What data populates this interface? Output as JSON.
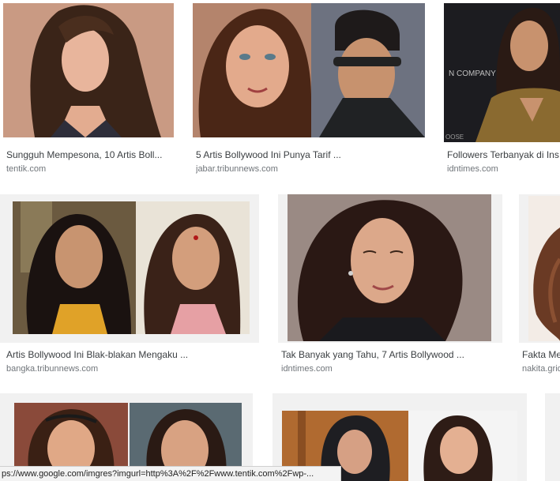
{
  "results": [
    {
      "title": "Sungguh Mempesona, 10 Artis Boll...",
      "source": "tentik.com"
    },
    {
      "title": "5 Artis Bollywood Ini Punya Tarif ...",
      "source": "jabar.tribunnews.com"
    },
    {
      "title": "Followers Terbanyak di Ins",
      "source": "idntimes.com"
    },
    {
      "title": "Artis Bollywood Ini Blak-blakan Mengaku ...",
      "source": "bangka.tribunnews.com"
    },
    {
      "title": "Tak Banyak yang Tahu, 7 Artis Bollywood ...",
      "source": "idntimes.com"
    },
    {
      "title": "Fakta Me",
      "source": "nakita.grid"
    }
  ],
  "thumbnail_text": {
    "company": "N COMPANY",
    "oose": "OOSE"
  },
  "status_bar": {
    "url": "ps://www.google.com/imgres?imgurl=http%3A%2F%2Fwww.tentik.com%2Fwp-..."
  },
  "colors": {
    "title": "#3c4043",
    "source": "#70757a",
    "frame": "#f1f1f1"
  }
}
